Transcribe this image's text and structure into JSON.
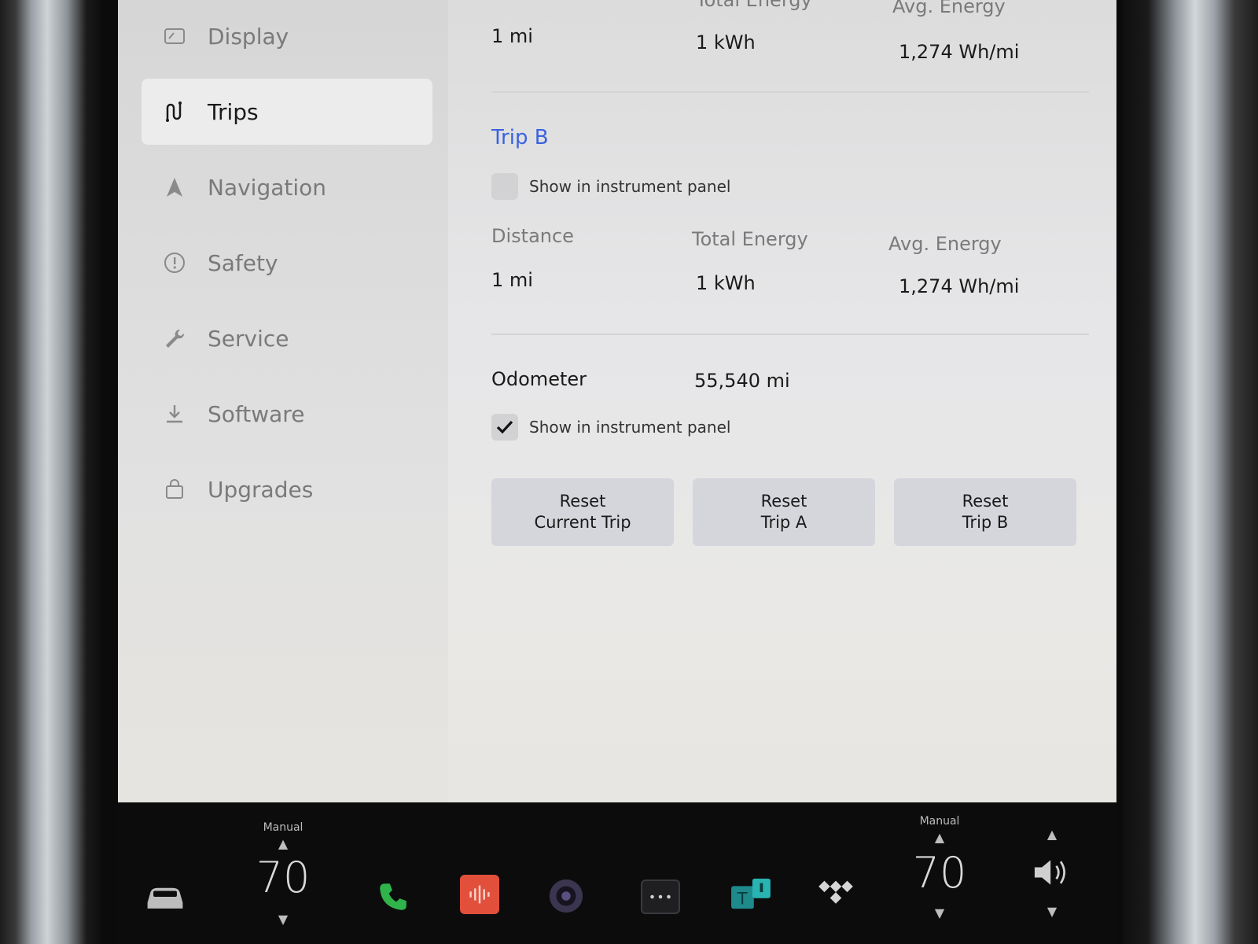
{
  "sidebar": {
    "items": [
      {
        "label": "Display",
        "icon": "display-icon"
      },
      {
        "label": "Trips",
        "icon": "trips-icon",
        "active": true
      },
      {
        "label": "Navigation",
        "icon": "navigation-icon"
      },
      {
        "label": "Safety",
        "icon": "safety-icon"
      },
      {
        "label": "Service",
        "icon": "wrench-icon"
      },
      {
        "label": "Software",
        "icon": "download-icon"
      },
      {
        "label": "Upgrades",
        "icon": "bag-icon"
      }
    ]
  },
  "trip_a": {
    "headers": [
      "Total Energy",
      "Avg. Energy"
    ],
    "distance": "1 mi",
    "total_energy": "1 kWh",
    "avg_energy": "1,274 Wh/mi"
  },
  "trip_b": {
    "title": "Trip B",
    "show_in_panel_label": "Show in instrument panel",
    "show_in_panel_checked": false,
    "headers": [
      "Distance",
      "Total Energy",
      "Avg. Energy"
    ],
    "distance": "1 mi",
    "total_energy": "1 kWh",
    "avg_energy": "1,274 Wh/mi"
  },
  "odometer": {
    "label": "Odometer",
    "value": "55,540 mi",
    "show_in_panel_label": "Show in instrument panel",
    "show_in_panel_checked": true
  },
  "buttons": {
    "reset_current": [
      "Reset",
      "Current Trip"
    ],
    "reset_trip_a": [
      "Reset",
      "Trip A"
    ],
    "reset_trip_b": [
      "Reset",
      "Trip B"
    ]
  },
  "taskbar": {
    "left_temp": {
      "mode": "Manual",
      "value": "70"
    },
    "right_temp": {
      "mode": "Manual",
      "value": "70"
    },
    "apps": [
      "car-icon",
      "phone-icon",
      "media-icon",
      "camera-icon",
      "more-apps-icon",
      "toybox-icon",
      "tidal-icon",
      "volume-icon"
    ]
  },
  "colors": {
    "accent": "#3a63e0",
    "phone": "#2fb34a",
    "media": "#e2503c"
  }
}
